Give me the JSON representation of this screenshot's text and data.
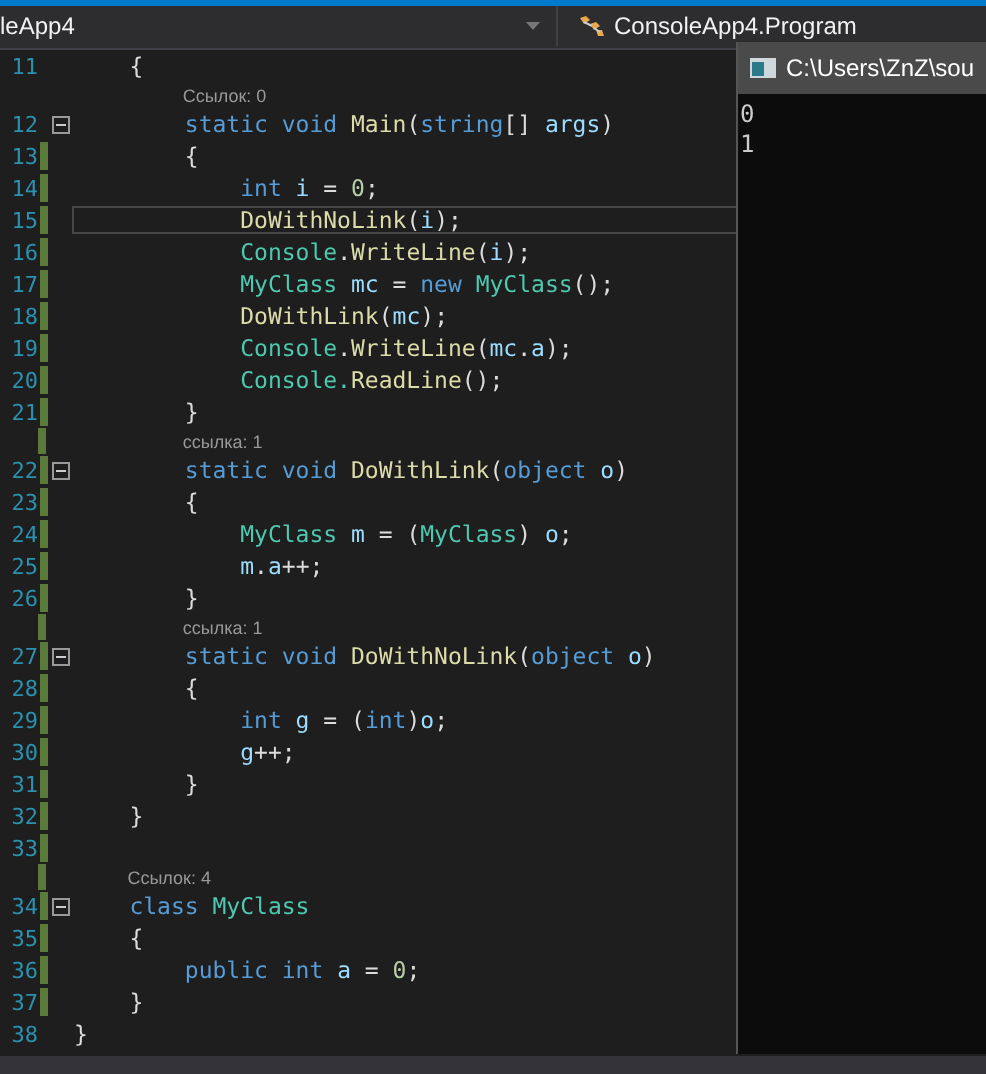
{
  "nav_bar": {
    "project": "leApp4",
    "class_scope": "ConsoleApp4.Program"
  },
  "editor": {
    "rows": [
      {
        "kind": "code",
        "number": "11",
        "changed": false,
        "fold": false,
        "current": false,
        "tokens": [
          {
            "kind": "p",
            "t": "    {"
          }
        ]
      },
      {
        "kind": "lens",
        "changed": false,
        "text": "        Ссылок: 0"
      },
      {
        "kind": "code",
        "number": "12",
        "changed": false,
        "fold": true,
        "current": false,
        "tokens": [
          {
            "kind": "kw",
            "t": "        static "
          },
          {
            "kind": "kw",
            "t": "void "
          },
          {
            "kind": "fn",
            "t": "Main"
          },
          {
            "kind": "p",
            "t": "("
          },
          {
            "kind": "kw",
            "t": "string"
          },
          {
            "kind": "p",
            "t": "[] "
          },
          {
            "kind": "var",
            "t": "args"
          },
          {
            "kind": "p",
            "t": ")"
          }
        ]
      },
      {
        "kind": "code",
        "number": "13",
        "changed": true,
        "fold": false,
        "current": false,
        "tokens": [
          {
            "kind": "p",
            "t": "        {"
          }
        ]
      },
      {
        "kind": "code",
        "number": "14",
        "changed": true,
        "fold": false,
        "current": false,
        "tokens": [
          {
            "kind": "kw",
            "t": "            int "
          },
          {
            "kind": "var",
            "t": "i"
          },
          {
            "kind": "p",
            "t": " = "
          },
          {
            "kind": "num",
            "t": "0"
          },
          {
            "kind": "p",
            "t": ";"
          }
        ]
      },
      {
        "kind": "code",
        "number": "15",
        "changed": true,
        "fold": false,
        "current": true,
        "tokens": [
          {
            "kind": "fn",
            "t": "            DoWithNoLink"
          },
          {
            "kind": "p",
            "t": "("
          },
          {
            "kind": "var",
            "t": "i"
          },
          {
            "kind": "p",
            "t": ");"
          }
        ]
      },
      {
        "kind": "code",
        "number": "16",
        "changed": true,
        "fold": false,
        "current": false,
        "tokens": [
          {
            "kind": "ty",
            "t": "            Console"
          },
          {
            "kind": "p",
            "t": "."
          },
          {
            "kind": "fn",
            "t": "WriteLine"
          },
          {
            "kind": "p",
            "t": "("
          },
          {
            "kind": "var",
            "t": "i"
          },
          {
            "kind": "p",
            "t": ");"
          }
        ]
      },
      {
        "kind": "code",
        "number": "17",
        "changed": true,
        "fold": false,
        "current": false,
        "tokens": [
          {
            "kind": "ty",
            "t": "            MyClass "
          },
          {
            "kind": "var",
            "t": "mc"
          },
          {
            "kind": "p",
            "t": " = "
          },
          {
            "kind": "kw",
            "t": "new "
          },
          {
            "kind": "ty",
            "t": "MyClass"
          },
          {
            "kind": "p",
            "t": "();"
          }
        ]
      },
      {
        "kind": "code",
        "number": "18",
        "changed": true,
        "fold": false,
        "current": false,
        "tokens": [
          {
            "kind": "fn",
            "t": "            DoWithLink"
          },
          {
            "kind": "p",
            "t": "("
          },
          {
            "kind": "var",
            "t": "mc"
          },
          {
            "kind": "p",
            "t": ");"
          }
        ]
      },
      {
        "kind": "code",
        "number": "19",
        "changed": true,
        "fold": false,
        "current": false,
        "tokens": [
          {
            "kind": "ty",
            "t": "            Console"
          },
          {
            "kind": "p",
            "t": "."
          },
          {
            "kind": "fn",
            "t": "WriteLine"
          },
          {
            "kind": "p",
            "t": "("
          },
          {
            "kind": "var",
            "t": "mc"
          },
          {
            "kind": "p",
            "t": "."
          },
          {
            "kind": "var",
            "t": "a"
          },
          {
            "kind": "p",
            "t": ");"
          }
        ]
      },
      {
        "kind": "code",
        "number": "20",
        "changed": true,
        "fold": false,
        "current": false,
        "tokens": [
          {
            "kind": "ty",
            "t": "            Console."
          },
          {
            "kind": "fn",
            "t": "ReadLine"
          },
          {
            "kind": "p",
            "t": "();"
          }
        ]
      },
      {
        "kind": "code",
        "number": "21",
        "changed": true,
        "fold": false,
        "current": false,
        "tokens": [
          {
            "kind": "p",
            "t": "        }"
          }
        ]
      },
      {
        "kind": "lens",
        "changed": true,
        "text": "        ссылка: 1"
      },
      {
        "kind": "code",
        "number": "22",
        "changed": true,
        "fold": true,
        "current": false,
        "tokens": [
          {
            "kind": "kw",
            "t": "        static "
          },
          {
            "kind": "kw",
            "t": "void "
          },
          {
            "kind": "fn",
            "t": "DoWithLink"
          },
          {
            "kind": "p",
            "t": "("
          },
          {
            "kind": "kw",
            "t": "object "
          },
          {
            "kind": "var",
            "t": "o"
          },
          {
            "kind": "p",
            "t": ")"
          }
        ]
      },
      {
        "kind": "code",
        "number": "23",
        "changed": true,
        "fold": false,
        "current": false,
        "tokens": [
          {
            "kind": "p",
            "t": "        {"
          }
        ]
      },
      {
        "kind": "code",
        "number": "24",
        "changed": true,
        "fold": false,
        "current": false,
        "tokens": [
          {
            "kind": "ty",
            "t": "            MyClass "
          },
          {
            "kind": "var",
            "t": "m"
          },
          {
            "kind": "p",
            "t": " = ("
          },
          {
            "kind": "ty",
            "t": "MyClass"
          },
          {
            "kind": "p",
            "t": ") "
          },
          {
            "kind": "var",
            "t": "o"
          },
          {
            "kind": "p",
            "t": ";"
          }
        ]
      },
      {
        "kind": "code",
        "number": "25",
        "changed": true,
        "fold": false,
        "current": false,
        "tokens": [
          {
            "kind": "var",
            "t": "            m"
          },
          {
            "kind": "p",
            "t": "."
          },
          {
            "kind": "var",
            "t": "a"
          },
          {
            "kind": "p",
            "t": "++;"
          }
        ]
      },
      {
        "kind": "code",
        "number": "26",
        "changed": true,
        "fold": false,
        "current": false,
        "tokens": [
          {
            "kind": "p",
            "t": "        }"
          }
        ]
      },
      {
        "kind": "lens",
        "changed": true,
        "text": "        ссылка: 1"
      },
      {
        "kind": "code",
        "number": "27",
        "changed": true,
        "fold": true,
        "current": false,
        "tokens": [
          {
            "kind": "kw",
            "t": "        static "
          },
          {
            "kind": "kw",
            "t": "void "
          },
          {
            "kind": "fn",
            "t": "DoWithNoLink"
          },
          {
            "kind": "p",
            "t": "("
          },
          {
            "kind": "kw",
            "t": "object "
          },
          {
            "kind": "var",
            "t": "o"
          },
          {
            "kind": "p",
            "t": ")"
          }
        ]
      },
      {
        "kind": "code",
        "number": "28",
        "changed": true,
        "fold": false,
        "current": false,
        "tokens": [
          {
            "kind": "p",
            "t": "        {"
          }
        ]
      },
      {
        "kind": "code",
        "number": "29",
        "changed": true,
        "fold": false,
        "current": false,
        "tokens": [
          {
            "kind": "kw",
            "t": "            int "
          },
          {
            "kind": "var",
            "t": "g"
          },
          {
            "kind": "p",
            "t": " = ("
          },
          {
            "kind": "kw",
            "t": "int"
          },
          {
            "kind": "p",
            "t": ")"
          },
          {
            "kind": "var",
            "t": "o"
          },
          {
            "kind": "p",
            "t": ";"
          }
        ]
      },
      {
        "kind": "code",
        "number": "30",
        "changed": true,
        "fold": false,
        "current": false,
        "tokens": [
          {
            "kind": "var",
            "t": "            g"
          },
          {
            "kind": "p",
            "t": "++;"
          }
        ]
      },
      {
        "kind": "code",
        "number": "31",
        "changed": true,
        "fold": false,
        "current": false,
        "tokens": [
          {
            "kind": "p",
            "t": "        }"
          }
        ]
      },
      {
        "kind": "code",
        "number": "32",
        "changed": true,
        "fold": false,
        "current": false,
        "tokens": [
          {
            "kind": "p",
            "t": "    }"
          }
        ]
      },
      {
        "kind": "code",
        "number": "33",
        "changed": true,
        "fold": false,
        "current": false,
        "tokens": []
      },
      {
        "kind": "lens",
        "changed": true,
        "text": "    Ссылок: 4"
      },
      {
        "kind": "code",
        "number": "34",
        "changed": true,
        "fold": true,
        "current": false,
        "tokens": [
          {
            "kind": "kw",
            "t": "    class "
          },
          {
            "kind": "ty",
            "t": "MyClass"
          }
        ]
      },
      {
        "kind": "code",
        "number": "35",
        "changed": true,
        "fold": false,
        "current": false,
        "tokens": [
          {
            "kind": "p",
            "t": "    {"
          }
        ]
      },
      {
        "kind": "code",
        "number": "36",
        "changed": true,
        "fold": false,
        "current": false,
        "tokens": [
          {
            "kind": "kw",
            "t": "        public "
          },
          {
            "kind": "kw",
            "t": "int "
          },
          {
            "kind": "var",
            "t": "a"
          },
          {
            "kind": "p",
            "t": " = "
          },
          {
            "kind": "num",
            "t": "0"
          },
          {
            "kind": "p",
            "t": ";"
          }
        ]
      },
      {
        "kind": "code",
        "number": "37",
        "changed": true,
        "fold": false,
        "current": false,
        "tokens": [
          {
            "kind": "p",
            "t": "    }"
          }
        ]
      },
      {
        "kind": "code",
        "number": "38",
        "changed": false,
        "fold": false,
        "current": false,
        "tokens": [
          {
            "kind": "p",
            "t": "}"
          }
        ]
      }
    ]
  },
  "console": {
    "title": "C:\\Users\\ZnZ\\sou",
    "output": [
      "0",
      "1"
    ]
  }
}
